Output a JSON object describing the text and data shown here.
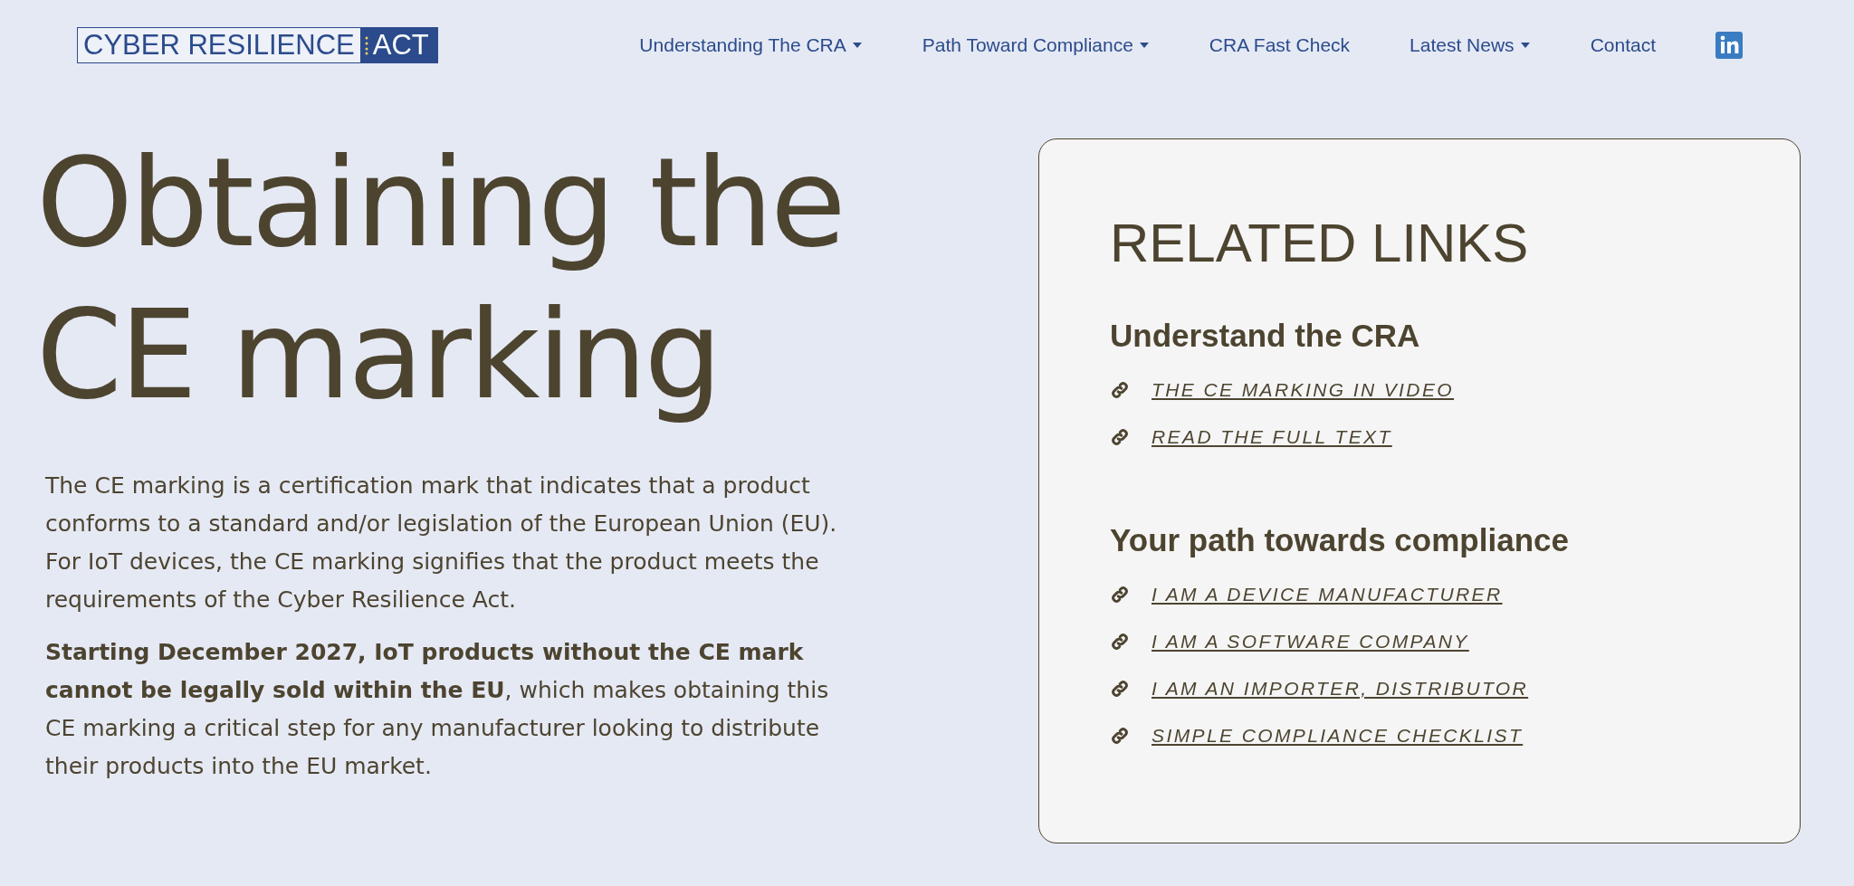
{
  "logo": {
    "left": "CYBER RESILIENCE",
    "right": "ACT"
  },
  "nav": [
    {
      "label": "Understanding The CRA",
      "dropdown": true
    },
    {
      "label": "Path Toward Compliance",
      "dropdown": true
    },
    {
      "label": "CRA Fast Check",
      "dropdown": false
    },
    {
      "label": "Latest News",
      "dropdown": true
    },
    {
      "label": "Contact",
      "dropdown": false
    }
  ],
  "title": [
    "Obtaining the",
    "CE marking"
  ],
  "paragraphs": [
    "The CE marking is a certification mark that indicates that a product conforms to a standard and/or legislation of the European Union (EU). For IoT devices, the CE marking signifies that the product meets the requirements of the Cyber Resilience Act.",
    "**Starting December 2027, IoT products without the CE mark cannot be legally sold within the EU**, which makes obtaining this CE marking a critical step for any manufacturer looking to distribute their products into the EU market."
  ],
  "related": {
    "title": "RELATED LINKS",
    "groups": [
      {
        "heading": "Understand the CRA",
        "links": [
          "THE CE MARKING IN VIDEO",
          "READ THE FULL TEXT"
        ]
      },
      {
        "heading": "Your path towards compliance",
        "links": [
          "I AM A DEVICE MANUFACTURER",
          "I AM A SOFTWARE COMPANY",
          "I AM AN IMPORTER, DISTRIBUTOR",
          "SIMPLE COMPLIANCE CHECKLIST"
        ]
      }
    ]
  }
}
